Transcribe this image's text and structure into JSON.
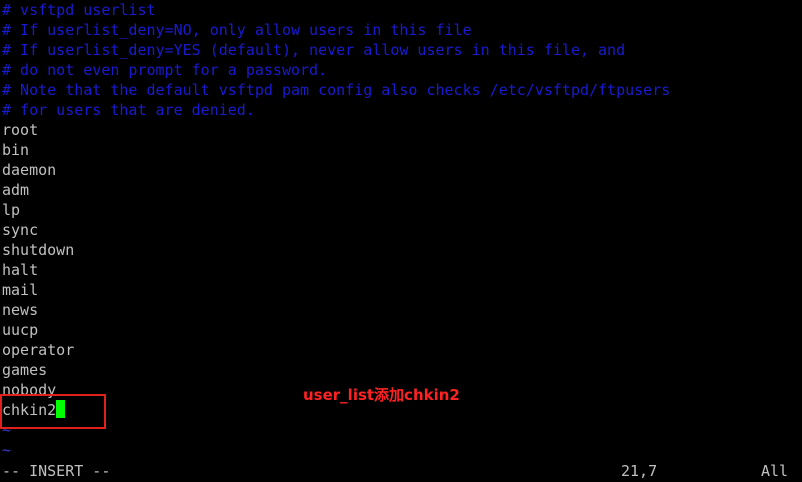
{
  "comments": [
    "# vsftpd userlist",
    "# If userlist_deny=NO, only allow users in this file",
    "# If userlist_deny=YES (default), never allow users in this file, and",
    "# do not even prompt for a password.",
    "# Note that the default vsftpd pam config also checks /etc/vsftpd/ftpusers",
    "# for users that are denied."
  ],
  "users": [
    "root",
    "bin",
    "daemon",
    "adm",
    "lp",
    "sync",
    "shutdown",
    "halt",
    "mail",
    "news",
    "uucp",
    "operator",
    "games",
    "nobody"
  ],
  "editing_line": "chkin2",
  "tildes": [
    "~",
    "~"
  ],
  "annotation": "user_list添加chkin2",
  "status_bar": {
    "mode": "-- INSERT --",
    "position": "21,7",
    "scroll": "All"
  },
  "colors": {
    "background": "#000000",
    "comment": "#1a1ad0",
    "text": "#c0c0c0",
    "cursor": "#00ff00",
    "annotation": "#ff2222"
  }
}
